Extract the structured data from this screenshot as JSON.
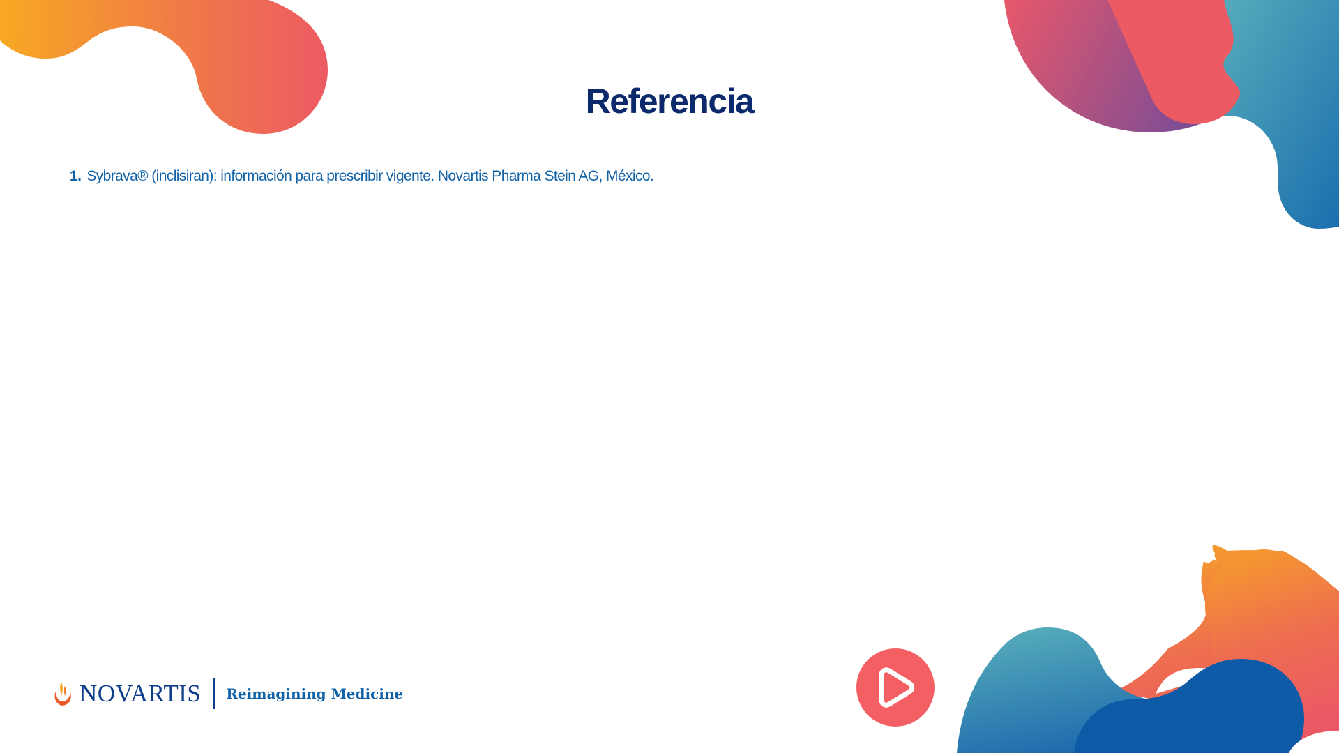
{
  "slide": {
    "title": "Referencia",
    "references": [
      {
        "number": "1.",
        "text": "Sybrava® (inclisiran): información para prescribir vigente. Novartis Pharma Stein AG, México."
      }
    ]
  },
  "branding": {
    "company": "NOVARTIS",
    "tagline": "Reimagining Medicine"
  },
  "controls": {
    "play_icon": "play-icon"
  },
  "colors": {
    "title": "#0c2a6b",
    "reference_text": "#1262a8",
    "play_button": "#f35f62",
    "accent_orange": "#f7a823",
    "accent_coral": "#ec5a63",
    "accent_teal": "#5aafbb",
    "accent_blue": "#0d5aa7"
  }
}
